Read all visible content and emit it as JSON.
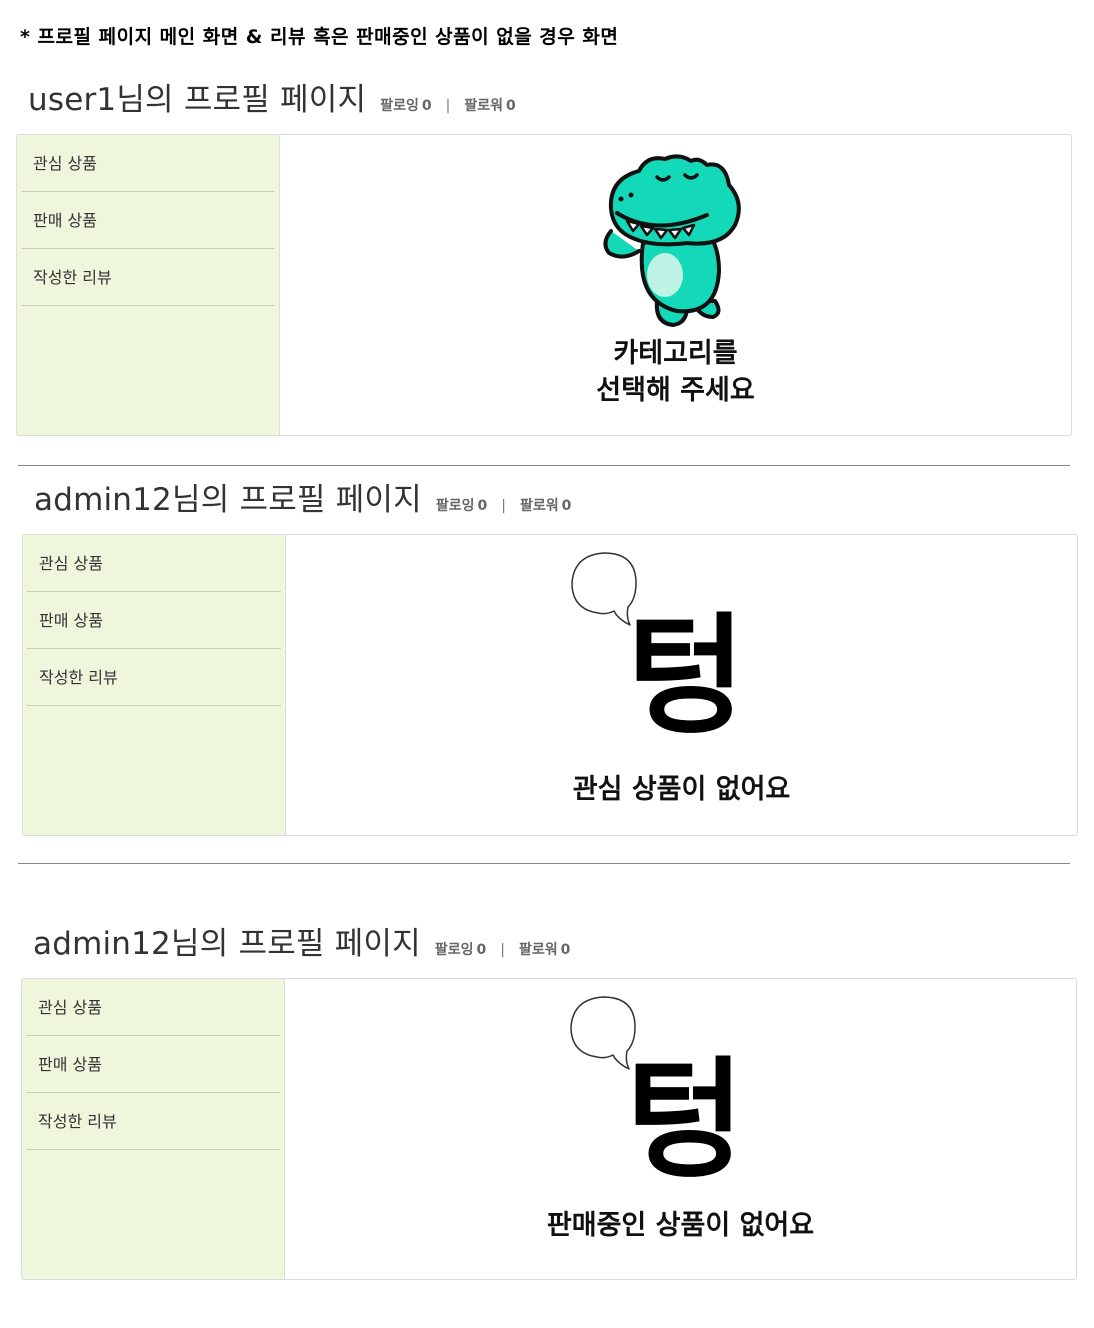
{
  "doc_title": "* 프로필 페이지 메인 화면 & 리뷰 혹은 판매중인 상품이 없을 경우 화면",
  "sections": [
    {
      "title": "user1님의 프로필 페이지",
      "following_label": "팔로잉",
      "following_count": "0",
      "follower_label": "팔로워",
      "follower_count": "0",
      "separator": "|",
      "menu": [
        "관심 상품",
        "판매 상품",
        "작성한 리뷰"
      ],
      "message_line1": "카테고리를",
      "message_line2": "선택해 주세요"
    },
    {
      "title": "admin12님의 프로필 페이지",
      "following_label": "팔로잉",
      "following_count": "0",
      "follower_label": "팔로워",
      "follower_count": "0",
      "separator": "|",
      "menu": [
        "관심 상품",
        "판매 상품",
        "작성한 리뷰"
      ],
      "empty_glyph": "텅",
      "message": "관심 상품이 없어요"
    },
    {
      "title": "admin12님의 프로필 페이지",
      "following_label": "팔로잉",
      "following_count": "0",
      "follower_label": "팔로워",
      "follower_count": "0",
      "separator": "|",
      "menu": [
        "관심 상품",
        "판매 상품",
        "작성한 리뷰"
      ],
      "empty_glyph": "텅",
      "message": "판매중인 상품이 없어요"
    }
  ],
  "colors": {
    "sidebar_bg": "#eef6dc",
    "mascot": "#14d9b8",
    "border": "#dcdcdc"
  },
  "icons": {
    "mascot": "crocodile-mascot-icon",
    "speech_bubble": "speech-bubble-icon"
  }
}
